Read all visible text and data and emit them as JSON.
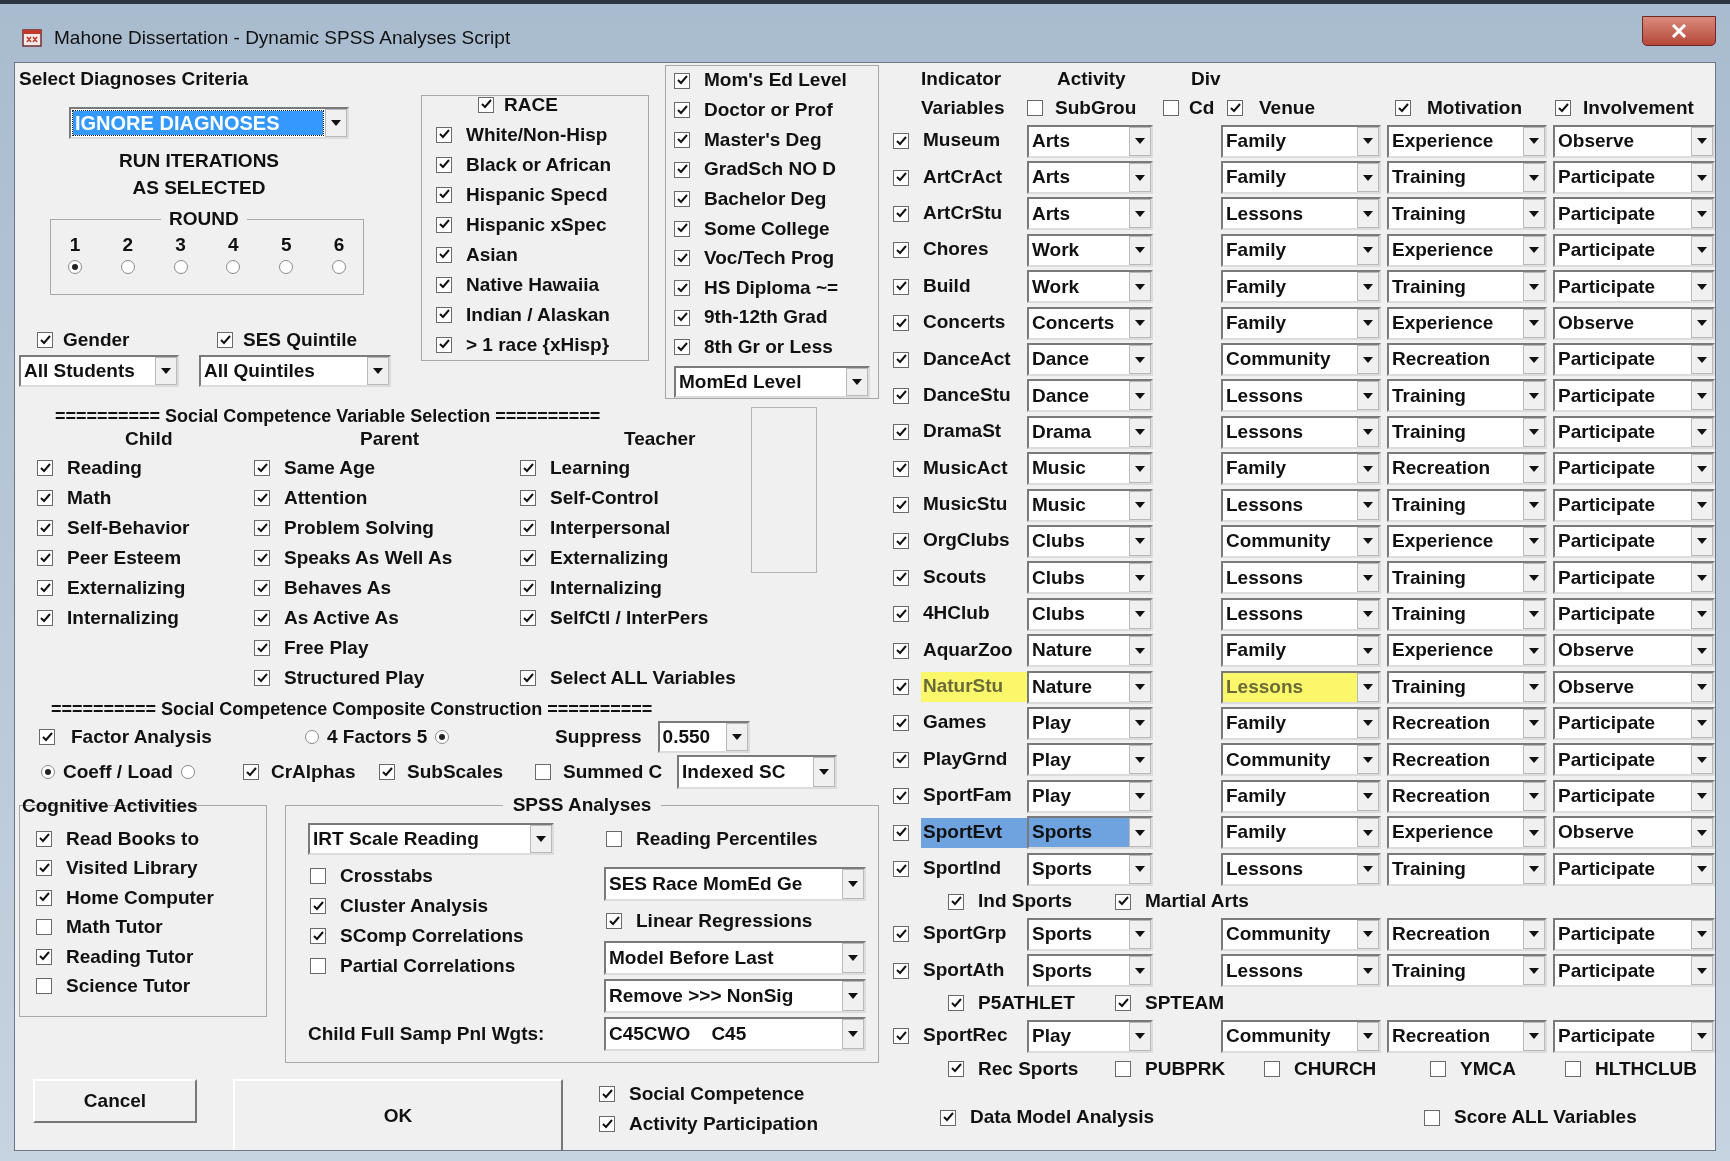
{
  "window": {
    "title": "Mahone Dissertation - Dynamic SPSS Analyses Script"
  },
  "diagnoses": {
    "heading": "Select Diagnoses Criteria",
    "dropdown": "IGNORE DIAGNOSES",
    "note_lines": [
      "RUN ITERATIONS",
      "AS SELECTED"
    ],
    "round": {
      "label": "ROUND",
      "options": [
        {
          "label": "1",
          "selected": true
        },
        {
          "label": "2",
          "selected": false
        },
        {
          "label": "3",
          "selected": false
        },
        {
          "label": "4",
          "selected": false
        },
        {
          "label": "5",
          "selected": false
        },
        {
          "label": "6",
          "selected": false
        }
      ]
    }
  },
  "gender": {
    "label": "Gender",
    "checked": true,
    "dropdown": "All Students"
  },
  "ses_quintile": {
    "label": "SES Quintile",
    "checked": true,
    "dropdown": "All Quintiles"
  },
  "race": {
    "label": "RACE",
    "checked": true,
    "items": [
      {
        "label": "White/Non-Hisp",
        "checked": true
      },
      {
        "label": "Black or African",
        "checked": true
      },
      {
        "label": "Hispanic Specd",
        "checked": true
      },
      {
        "label": "Hispanic xSpec",
        "checked": true
      },
      {
        "label": "Asian",
        "checked": true
      },
      {
        "label": "Native Hawaiia",
        "checked": true
      },
      {
        "label": "Indian / Alaskan",
        "checked": true
      },
      {
        "label": "> 1 race {xHisp}",
        "checked": true
      }
    ]
  },
  "moms_ed": {
    "label": "Mom's Ed Level",
    "checked": true,
    "items": [
      {
        "label": "Doctor or Prof",
        "checked": true
      },
      {
        "label": "Master's Deg",
        "checked": true
      },
      {
        "label": "GradSch NO D",
        "checked": true
      },
      {
        "label": "Bachelor Deg",
        "checked": true
      },
      {
        "label": "Some College",
        "checked": true
      },
      {
        "label": "Voc/Tech Prog",
        "checked": true
      },
      {
        "label": "HS Diploma ~=",
        "checked": true
      },
      {
        "label": "9th-12th Grad",
        "checked": true
      },
      {
        "label": "8th Gr or Less",
        "checked": true
      }
    ],
    "dropdown": "MomEd Level"
  },
  "sc_selection": {
    "heading": "========== Social Competence Variable Selection ==========",
    "columns": [
      {
        "title": "Child",
        "items": [
          {
            "label": "Reading",
            "checked": true
          },
          {
            "label": "Math",
            "checked": true
          },
          {
            "label": "Self-Behavior",
            "checked": true
          },
          {
            "label": "Peer Esteem",
            "checked": true
          },
          {
            "label": "Externalizing",
            "checked": true
          },
          {
            "label": "Internalizing",
            "checked": true
          }
        ]
      },
      {
        "title": "Parent",
        "items": [
          {
            "label": "Same Age",
            "checked": true
          },
          {
            "label": "Attention",
            "checked": true
          },
          {
            "label": "Problem Solving",
            "checked": true
          },
          {
            "label": "Speaks As Well As",
            "checked": true
          },
          {
            "label": "Behaves As",
            "checked": true
          },
          {
            "label": "As Active As",
            "checked": true
          },
          {
            "label": "Free Play",
            "checked": true
          },
          {
            "label": "Structured Play",
            "checked": true
          }
        ]
      },
      {
        "title": "Teacher",
        "items": [
          {
            "label": "Learning",
            "checked": true
          },
          {
            "label": "Self-Control",
            "checked": true
          },
          {
            "label": "Interpersonal",
            "checked": true
          },
          {
            "label": "Externalizing",
            "checked": true
          },
          {
            "label": "Internalizing",
            "checked": true
          },
          {
            "label": "SelfCtl / InterPers",
            "checked": true
          }
        ]
      }
    ],
    "select_all": {
      "label": "Select ALL Variables",
      "checked": true
    }
  },
  "composite": {
    "heading": "========== Social Competence Composite Construction ==========",
    "factor_analysis": {
      "label": "Factor Analysis",
      "checked": true
    },
    "factors": {
      "label": "4 Factors 5",
      "radios": [
        {
          "selected": false
        },
        {
          "selected": true
        }
      ]
    },
    "suppress": {
      "label": "Suppress",
      "dropdown": "0.550"
    },
    "coeff": {
      "label": "Coeff / Load",
      "radios": [
        {
          "selected": true
        },
        {
          "selected": false
        }
      ]
    },
    "checks": [
      {
        "label": "CrAlphas",
        "checked": true
      },
      {
        "label": "SubScales",
        "checked": true
      },
      {
        "label": "Summed C",
        "checked": false
      }
    ],
    "dropdown": "Indexed SC"
  },
  "cognitive": {
    "title": "Cognitive Activities",
    "items": [
      {
        "label": "Read Books to",
        "checked": true
      },
      {
        "label": "Visited Library",
        "checked": true
      },
      {
        "label": "Home Computer",
        "checked": true
      },
      {
        "label": "Math Tutor",
        "checked": false
      },
      {
        "label": "Reading Tutor",
        "checked": true
      },
      {
        "label": "Science Tutor",
        "checked": false
      }
    ]
  },
  "spss": {
    "title": "SPSS Analyses",
    "analysis_dropdown": "IRT Scale Reading",
    "checks": [
      {
        "label": "Crosstabs",
        "checked": false
      },
      {
        "label": "Cluster Analysis",
        "checked": true
      },
      {
        "label": "SComp Correlations",
        "checked": true
      },
      {
        "label": "Partial Correlations",
        "checked": false
      }
    ],
    "reading_percentiles": {
      "label": "Reading Percentiles",
      "checked": false
    },
    "group_dropdown": "SES Race MomEd Ge",
    "linear_regressions": {
      "label": "Linear Regressions",
      "checked": true
    },
    "model_dropdown": "Model Before Last",
    "remove_dropdown": "Remove >>> NonSig",
    "weights": {
      "label": "Child Full Samp Pnl Wgts:",
      "dropdown": "C45CWO    C45"
    }
  },
  "buttons": {
    "cancel": "Cancel",
    "ok": "OK"
  },
  "output_checks": [
    {
      "label": "Social Competence",
      "checked": true
    },
    {
      "label": "Activity Participation",
      "checked": true
    }
  ],
  "indicator_header": {
    "title_lines": [
      "Indicator",
      "Variables"
    ],
    "activity": "Activity",
    "subgroup": {
      "label": "SubGrou",
      "checked": false
    },
    "div": "Div",
    "cd": {
      "label": "Cd",
      "checked": false
    },
    "venue": {
      "label": "Venue",
      "checked": true
    },
    "motivation": {
      "label": "Motivation",
      "checked": true
    },
    "involvement": {
      "label": "Involvement",
      "checked": true
    }
  },
  "activities": [
    {
      "kind": "activity",
      "name": "Museum",
      "checked": true,
      "activity": "Arts",
      "venue": "Family",
      "motivation": "Experience",
      "involvement": "Observe",
      "selected": false,
      "flagged": false
    },
    {
      "kind": "activity",
      "name": "ArtCrAct",
      "checked": true,
      "activity": "Arts",
      "venue": "Family",
      "motivation": "Training",
      "involvement": "Participate",
      "selected": false,
      "flagged": false
    },
    {
      "kind": "activity",
      "name": "ArtCrStu",
      "checked": true,
      "activity": "Arts",
      "venue": "Lessons",
      "motivation": "Training",
      "involvement": "Participate",
      "selected": false,
      "flagged": false
    },
    {
      "kind": "activity",
      "name": "Chores",
      "checked": true,
      "activity": "Work",
      "venue": "Family",
      "motivation": "Experience",
      "involvement": "Participate",
      "selected": false,
      "flagged": false
    },
    {
      "kind": "activity",
      "name": "Build",
      "checked": true,
      "activity": "Work",
      "venue": "Family",
      "motivation": "Training",
      "involvement": "Participate",
      "selected": false,
      "flagged": false
    },
    {
      "kind": "activity",
      "name": "Concerts",
      "checked": true,
      "activity": "Concerts",
      "venue": "Family",
      "motivation": "Experience",
      "involvement": "Observe",
      "selected": false,
      "flagged": false
    },
    {
      "kind": "activity",
      "name": "DanceAct",
      "checked": true,
      "activity": "Dance",
      "venue": "Community",
      "motivation": "Recreation",
      "involvement": "Participate",
      "selected": false,
      "flagged": false
    },
    {
      "kind": "activity",
      "name": "DanceStu",
      "checked": true,
      "activity": "Dance",
      "venue": "Lessons",
      "motivation": "Training",
      "involvement": "Participate",
      "selected": false,
      "flagged": false
    },
    {
      "kind": "activity",
      "name": "DramaSt",
      "checked": true,
      "activity": "Drama",
      "venue": "Lessons",
      "motivation": "Training",
      "involvement": "Participate",
      "selected": false,
      "flagged": false
    },
    {
      "kind": "activity",
      "name": "MusicAct",
      "checked": true,
      "activity": "Music",
      "venue": "Family",
      "motivation": "Recreation",
      "involvement": "Participate",
      "selected": false,
      "flagged": false
    },
    {
      "kind": "activity",
      "name": "MusicStu",
      "checked": true,
      "activity": "Music",
      "venue": "Lessons",
      "motivation": "Training",
      "involvement": "Participate",
      "selected": false,
      "flagged": false
    },
    {
      "kind": "activity",
      "name": "OrgClubs",
      "checked": true,
      "activity": "Clubs",
      "venue": "Community",
      "motivation": "Experience",
      "involvement": "Participate",
      "selected": false,
      "flagged": false
    },
    {
      "kind": "activity",
      "name": "Scouts",
      "checked": true,
      "activity": "Clubs",
      "venue": "Lessons",
      "motivation": "Training",
      "involvement": "Participate",
      "selected": false,
      "flagged": false
    },
    {
      "kind": "activity",
      "name": "4HClub",
      "checked": true,
      "activity": "Clubs",
      "venue": "Lessons",
      "motivation": "Training",
      "involvement": "Participate",
      "selected": false,
      "flagged": false
    },
    {
      "kind": "activity",
      "name": "AquarZoo",
      "checked": true,
      "activity": "Nature",
      "venue": "Family",
      "motivation": "Experience",
      "involvement": "Observe",
      "selected": false,
      "flagged": false
    },
    {
      "kind": "activity",
      "name": "NaturStu",
      "checked": true,
      "activity": "Nature",
      "venue": "Lessons",
      "motivation": "Training",
      "involvement": "Observe",
      "selected": false,
      "flagged": true
    },
    {
      "kind": "activity",
      "name": "Games",
      "checked": true,
      "activity": "Play",
      "venue": "Family",
      "motivation": "Recreation",
      "involvement": "Participate",
      "selected": false,
      "flagged": false
    },
    {
      "kind": "activity",
      "name": "PlayGrnd",
      "checked": true,
      "activity": "Play",
      "venue": "Community",
      "motivation": "Recreation",
      "involvement": "Participate",
      "selected": false,
      "flagged": false
    },
    {
      "kind": "activity",
      "name": "SportFam",
      "checked": true,
      "activity": "Play",
      "venue": "Family",
      "motivation": "Recreation",
      "involvement": "Participate",
      "selected": false,
      "flagged": false
    },
    {
      "kind": "activity",
      "name": "SportEvt",
      "checked": true,
      "activity": "Sports",
      "venue": "Family",
      "motivation": "Experience",
      "involvement": "Observe",
      "selected": true,
      "flagged": false
    },
    {
      "kind": "activity",
      "name": "SportInd",
      "checked": true,
      "activity": "Sports",
      "venue": "Lessons",
      "motivation": "Training",
      "involvement": "Participate",
      "selected": false,
      "flagged": false
    },
    {
      "kind": "options",
      "options": [
        {
          "label": "Ind Sports",
          "checked": true
        },
        {
          "label": "Martial Arts",
          "checked": true
        }
      ]
    },
    {
      "kind": "activity",
      "name": "SportGrp",
      "checked": true,
      "activity": "Sports",
      "venue": "Community",
      "motivation": "Recreation",
      "involvement": "Participate",
      "selected": false,
      "flagged": false
    },
    {
      "kind": "activity",
      "name": "SportAth",
      "checked": true,
      "activity": "Sports",
      "venue": "Lessons",
      "motivation": "Training",
      "involvement": "Participate",
      "selected": false,
      "flagged": false
    },
    {
      "kind": "options",
      "options": [
        {
          "label": "P5ATHLET",
          "checked": true
        },
        {
          "label": "SPTEAM",
          "checked": true
        }
      ]
    },
    {
      "kind": "activity",
      "name": "SportRec",
      "checked": true,
      "activity": "Play",
      "venue": "Community",
      "motivation": "Recreation",
      "involvement": "Participate",
      "selected": false,
      "flagged": false
    },
    {
      "kind": "options",
      "options": [
        {
          "label": "Rec Sports",
          "checked": true
        },
        {
          "label": "PUBPRK",
          "checked": false
        },
        {
          "label": "CHURCH",
          "checked": false
        },
        {
          "label": "YMCA",
          "checked": false
        },
        {
          "label": "HLTHCLUB",
          "checked": false
        }
      ]
    }
  ],
  "final_checks": [
    {
      "label": "Data Model Analysis",
      "checked": true
    },
    {
      "label": "Score ALL Variables",
      "checked": false
    }
  ]
}
